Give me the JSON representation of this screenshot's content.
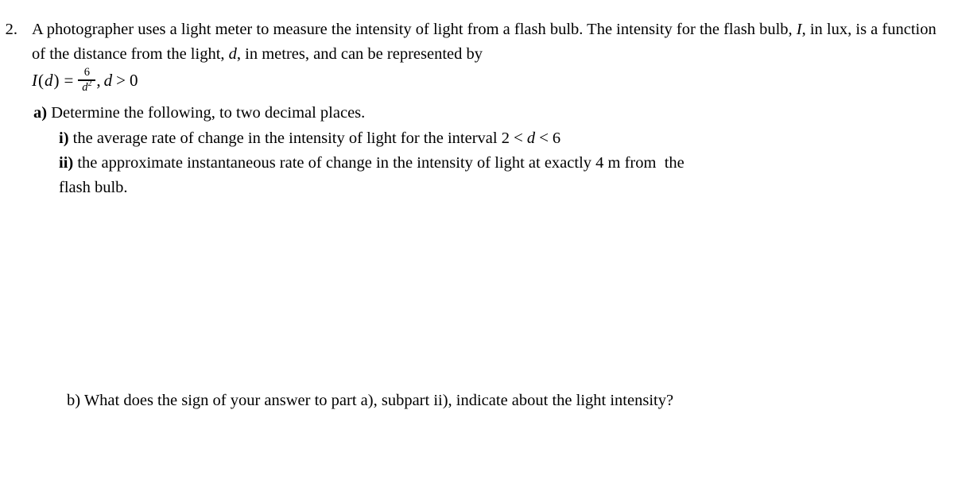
{
  "document": {
    "question_number": "2.",
    "intro": {
      "text_before_I": "A photographer uses a light meter to measure the intensity of light from a flash bulb. The intensity for the flash bulb, ",
      "var_I": "I",
      "text_middle": ", in lux, is a function of the distance from the light, ",
      "var_d": "d",
      "text_after": ", in metres, and can be represented by"
    },
    "equation": {
      "lhs_var": "I",
      "lhs_open": "(",
      "lhs_arg": "d",
      "lhs_close": ")",
      "equals": "=",
      "numerator": "6",
      "denominator_base": "d",
      "denominator_exp": "2",
      "comma": ",",
      "domain_var": "d",
      "domain_op": ">",
      "domain_value": "0"
    },
    "part_a": {
      "label": "a)",
      "text": " Determine the following, to two decimal places.",
      "subitems": [
        {
          "label": "i)",
          "text_before": " the average rate of change in the intensity of light for the interval ",
          "interval_lower": "2",
          "interval_op1": "<",
          "interval_var": "d",
          "interval_op2": "<",
          "interval_upper": "6"
        },
        {
          "label": "ii)",
          "text": " the approximate instantaneous rate of change in the intensity of light at exactly 4 m from  the",
          "continuation": "flash bulb."
        }
      ]
    },
    "part_b": {
      "label": "b)",
      "text": " What does the sign of your answer to part a), subpart ii), indicate about the light intensity?"
    }
  }
}
